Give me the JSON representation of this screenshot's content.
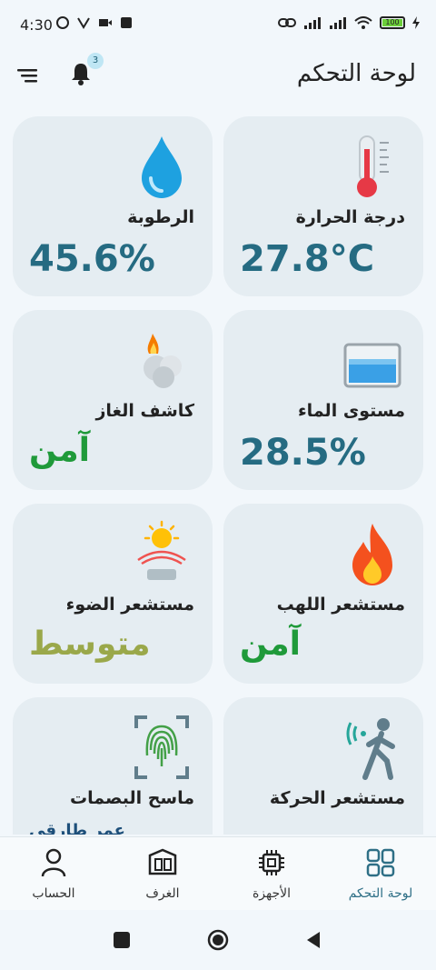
{
  "status_bar": {
    "time": "4:30",
    "battery": "100"
  },
  "header": {
    "title": "لوحة التحكم",
    "notification_count": "3"
  },
  "cards": [
    {
      "label": "درجة الحرارة",
      "value": "27.8°C",
      "icon": "thermometer-icon"
    },
    {
      "label": "الرطوبة",
      "value": "45.6%",
      "icon": "water-drop-icon"
    },
    {
      "label": "مستوى الماء",
      "value": "28.5%",
      "icon": "water-tank-icon"
    },
    {
      "label": "كاشف الغاز",
      "status": "آمن",
      "status_color": "#1f9a3a",
      "icon": "gas-detector-icon"
    },
    {
      "label": "مستشعر اللهب",
      "status": "آمن",
      "status_color": "#1f9a3a",
      "icon": "flame-icon"
    },
    {
      "label": "مستشعر الضوء",
      "status": "متوسط",
      "status_color": "#9aa84a",
      "icon": "sun-light-icon"
    },
    {
      "label": "مستشعر الحركة",
      "icon": "motion-sensor-icon"
    },
    {
      "label": "ماسح البصمات",
      "status": "عمر طارقي",
      "status_color": "#1d4f7a",
      "icon": "fingerprint-icon"
    }
  ],
  "bottom_nav": [
    {
      "label": "لوحة التحكم",
      "icon": "dashboard-icon",
      "active": true
    },
    {
      "label": "الأجهزة",
      "icon": "chip-icon",
      "active": false
    },
    {
      "label": "الغرف",
      "icon": "rooms-icon",
      "active": false
    },
    {
      "label": "الحساب",
      "icon": "account-icon",
      "active": false
    }
  ],
  "colors": {
    "accent": "#256b82",
    "safe": "#1f9a3a",
    "medium": "#9aa84a",
    "card_bg": "#e5edf2",
    "page_bg": "#f2f7fb"
  }
}
